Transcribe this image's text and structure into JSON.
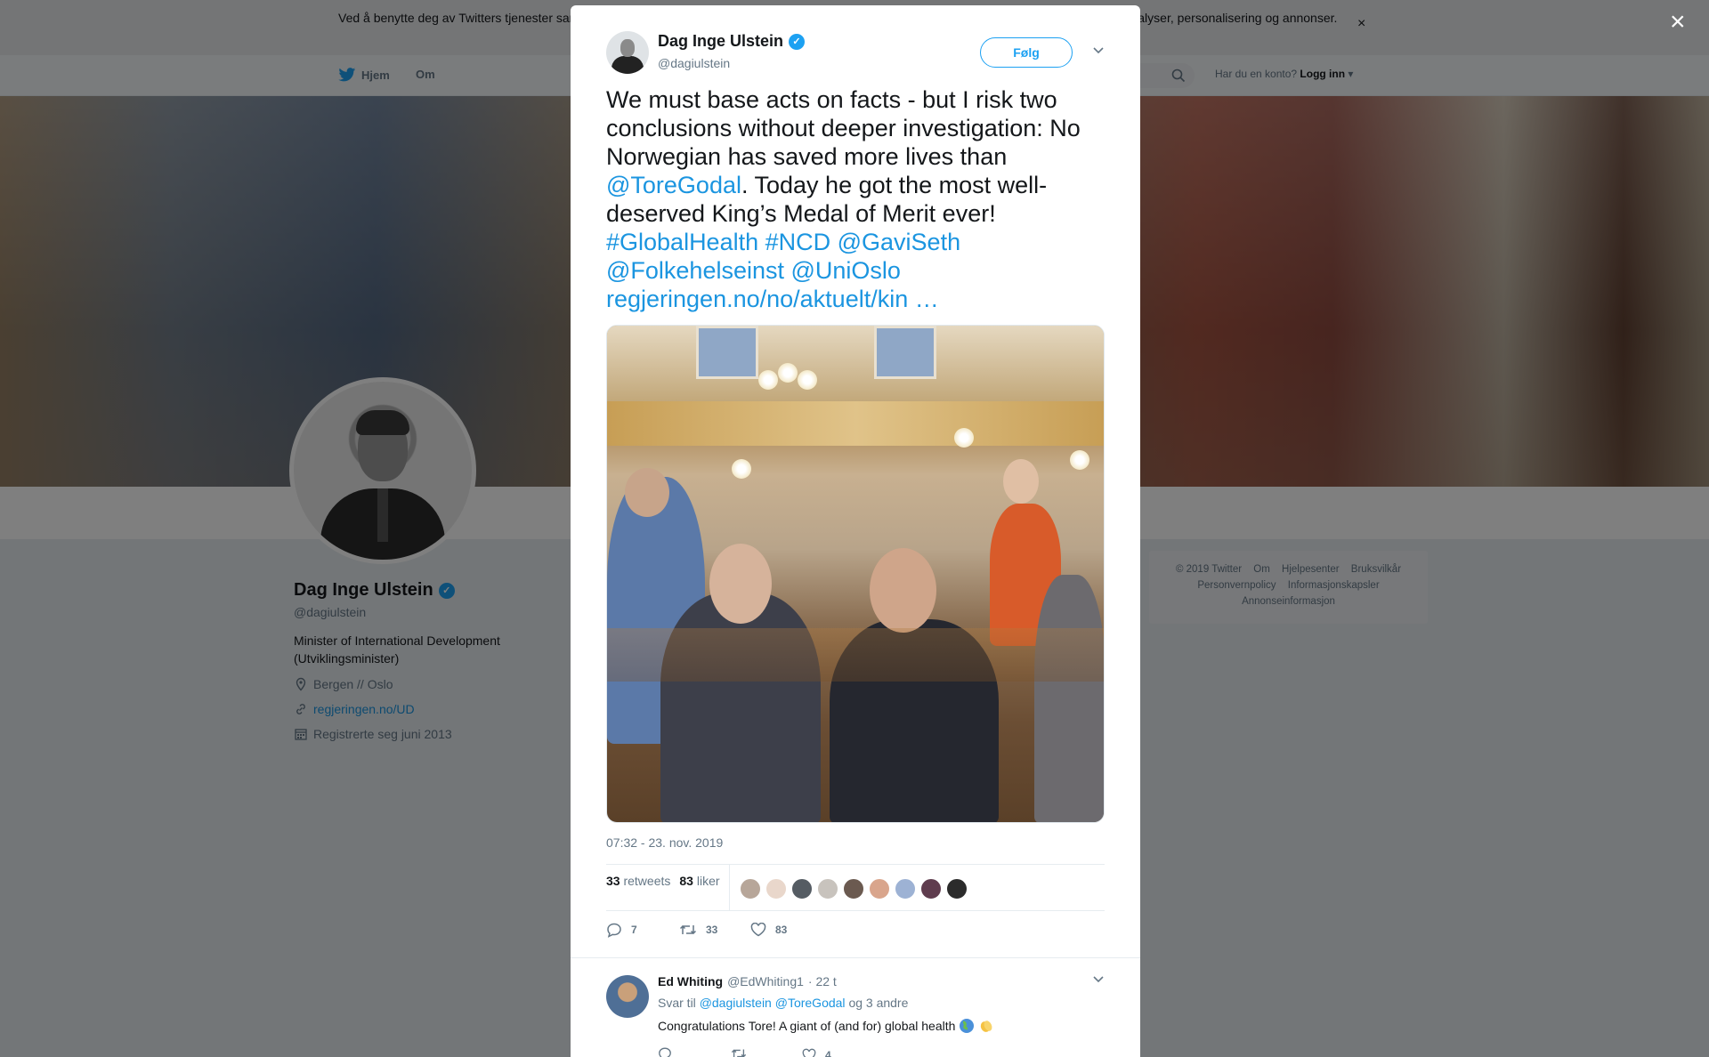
{
  "cookie_banner": {
    "text": "Ved å benytte deg av Twitters tjenester samtykker du i vår bruk av informasjonskapsler. Vi og våre partnere bruker informasjonskapsler til bl.a. analyser, personalisering og annonser.",
    "close": "×"
  },
  "nav": {
    "home": "Hjem",
    "about": "Om",
    "account_prompt": "Har du en konto?",
    "login": "Logg inn"
  },
  "profile": {
    "name": "Dag Inge Ulstein",
    "handle": "@dagiulstein",
    "bio": "Minister of International Development (Utviklingsminister)",
    "location": "Bergen // Oslo",
    "website": "regjeringen.no/UD",
    "joined": "Registrerte seg juni 2013"
  },
  "footer": {
    "links": [
      "© 2019 Twitter",
      "Om",
      "Hjelpesenter",
      "Bruksvilkår",
      "Personvernpolicy",
      "Informasjonskapsler",
      "Annonseinformasjon"
    ]
  },
  "modal": {
    "close": "×",
    "tweet": {
      "author_name": "Dag Inge Ulstein",
      "author_handle": "@dagiulstein",
      "follow_label": "Følg",
      "text_part1": "We must base acts on facts - but I risk two conclusions without deeper investigation: No Norwegian has saved more lives than ",
      "mention_toregodal": "@ToreGodal",
      "text_part2": ". Today he got the most well-deserved King’s Medal of Merit ever!",
      "tags_line1": "#GlobalHealth #NCD @GaviSeth",
      "tags_line2": "@Folkehelseinst @UniOslo",
      "link": " regjeringen.no/no/aktuelt/kin …",
      "timestamp": "07:32 - 23. nov. 2019",
      "retweets_count": "33",
      "retweets_label": "retweets",
      "likes_count": "83",
      "likes_label": "liker",
      "reply_count": "7",
      "retweet_action_count": "33",
      "like_action_count": "83"
    },
    "reply": {
      "name": "Ed Whiting",
      "handle": "@EdWhiting1",
      "time": "· 22 t",
      "reply_to_label": "Svar til",
      "reply_to_1": "@dagiulstein",
      "reply_to_2": "@ToreGodal",
      "reply_to_more": "og 3 andre",
      "text": "Congratulations Tore! A giant of (and for) global health",
      "like_count": "4"
    }
  },
  "colors": {
    "twitter_blue": "#1da1f2",
    "link_blue": "#1b95e0",
    "gray_text": "#657786"
  }
}
